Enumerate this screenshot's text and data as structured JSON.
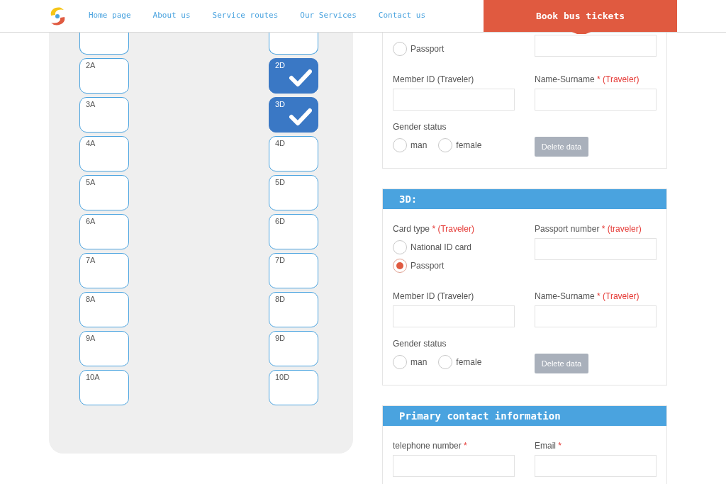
{
  "nav": {
    "links": [
      {
        "label": "Home page"
      },
      {
        "label": "About us"
      },
      {
        "label": "Service routes"
      },
      {
        "label": "Our Services"
      },
      {
        "label": "Contact us"
      }
    ],
    "cta": "Book bus tickets"
  },
  "seats": [
    {
      "left": {
        "selected": false
      },
      "right": {
        "selected": false
      }
    },
    {
      "left": {
        "label": "2A",
        "selected": false
      },
      "right": {
        "label": "2D",
        "selected": true
      }
    },
    {
      "left": {
        "label": "3A",
        "selected": false
      },
      "right": {
        "label": "3D",
        "selected": true
      }
    },
    {
      "left": {
        "label": "4A",
        "selected": false
      },
      "right": {
        "label": "4D",
        "selected": false
      }
    },
    {
      "left": {
        "label": "5A",
        "selected": false
      },
      "right": {
        "label": "5D",
        "selected": false
      }
    },
    {
      "left": {
        "label": "6A",
        "selected": false
      },
      "right": {
        "label": "6D",
        "selected": false
      }
    },
    {
      "left": {
        "label": "7A",
        "selected": false
      },
      "right": {
        "label": "7D",
        "selected": false
      }
    },
    {
      "left": {
        "label": "8A",
        "selected": false
      },
      "right": {
        "label": "8D",
        "selected": false
      }
    },
    {
      "left": {
        "label": "9A",
        "selected": false
      },
      "right": {
        "label": "9D",
        "selected": false
      }
    },
    {
      "left": {
        "label": "10A",
        "selected": false
      },
      "right": {
        "label": "10D",
        "selected": false
      }
    }
  ],
  "passengers": [
    {
      "card_type": {
        "options": [
          {
            "label": "Passport",
            "selected": false
          }
        ]
      },
      "member": {
        "label": "Member ID (Traveler)"
      },
      "name": {
        "label": "Name-Surname",
        "required": "* (Traveler)"
      },
      "gender": {
        "label": "Gender status",
        "options": [
          {
            "label": "man",
            "selected": false
          },
          {
            "label": "female",
            "selected": false
          }
        ]
      },
      "delete_button": "Delete data"
    },
    {
      "title": "3D:",
      "card_type": {
        "label": "Card type",
        "required": "* (Traveler)",
        "options": [
          {
            "label": "National ID card",
            "selected": false
          },
          {
            "label": "Passport",
            "selected": true
          }
        ]
      },
      "passport": {
        "label": "Passport number",
        "required": "* (traveler)"
      },
      "member": {
        "label": "Member ID (Traveler)"
      },
      "name": {
        "label": "Name-Surname",
        "required": "* (Traveler)"
      },
      "gender": {
        "label": "Gender status",
        "options": [
          {
            "label": "man",
            "selected": false
          },
          {
            "label": "female",
            "selected": false
          }
        ]
      },
      "delete_button": "Delete data"
    }
  ],
  "contact": {
    "title": "Primary contact information",
    "fields": [
      {
        "label": "telephone number",
        "required": "*"
      },
      {
        "label": "Email",
        "required": "*"
      }
    ]
  }
}
